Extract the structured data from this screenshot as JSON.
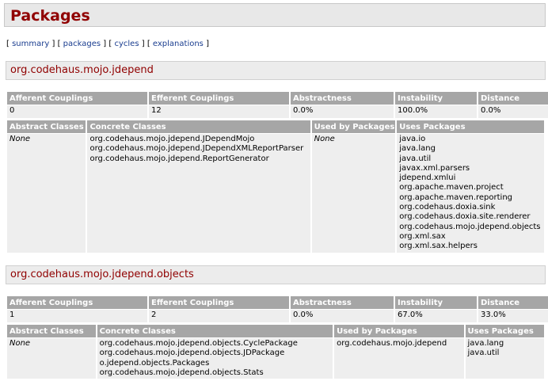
{
  "page_title": "Packages",
  "nav": {
    "open": "[",
    "summary": "summary",
    "packages": "packages",
    "cycles": "cycles",
    "explanations": "explanations",
    "close": "]"
  },
  "metric_headers": [
    "Afferent Couplings",
    "Efferent Couplings",
    "Abstractness",
    "Instability",
    "Distance"
  ],
  "detail_headers": [
    "Abstract Classes",
    "Concrete Classes",
    "Used by Packages",
    "Uses Packages"
  ],
  "packages": [
    {
      "name": "org.codehaus.mojo.jdepend",
      "metrics": [
        "0",
        "12",
        "0.0%",
        "100.0%",
        "0.0%"
      ],
      "abstract_classes": "None",
      "concrete_classes": [
        "org.codehaus.mojo.jdepend.JDependMojo",
        "org.codehaus.mojo.jdepend.JDependXMLReportParser",
        "org.codehaus.mojo.jdepend.ReportGenerator"
      ],
      "used_by_packages": "None",
      "uses_packages": [
        "java.io",
        "java.lang",
        "java.util",
        "javax.xml.parsers",
        "jdepend.xmlui",
        "org.apache.maven.project",
        "org.apache.maven.reporting",
        "org.codehaus.doxia.sink",
        "org.codehaus.doxia.site.renderer",
        "org.codehaus.mojo.jdepend.objects",
        "org.xml.sax",
        "org.xml.sax.helpers"
      ]
    },
    {
      "name": "org.codehaus.mojo.jdepend.objects",
      "metrics": [
        "1",
        "2",
        "0.0%",
        "67.0%",
        "33.0%"
      ],
      "abstract_classes": "None",
      "concrete_classes": [
        "org.codehaus.mojo.jdepend.objects.CyclePackage",
        "org.codehaus.mojo.jdepend.objects.JDPackage",
        "o.jdepend.objects.Packages",
        "org.codehaus.mojo.jdepend.objects.Stats"
      ],
      "used_by_packages": "org.codehaus.mojo.jdepend",
      "uses_packages": [
        "java.lang",
        "java.util"
      ]
    }
  ]
}
